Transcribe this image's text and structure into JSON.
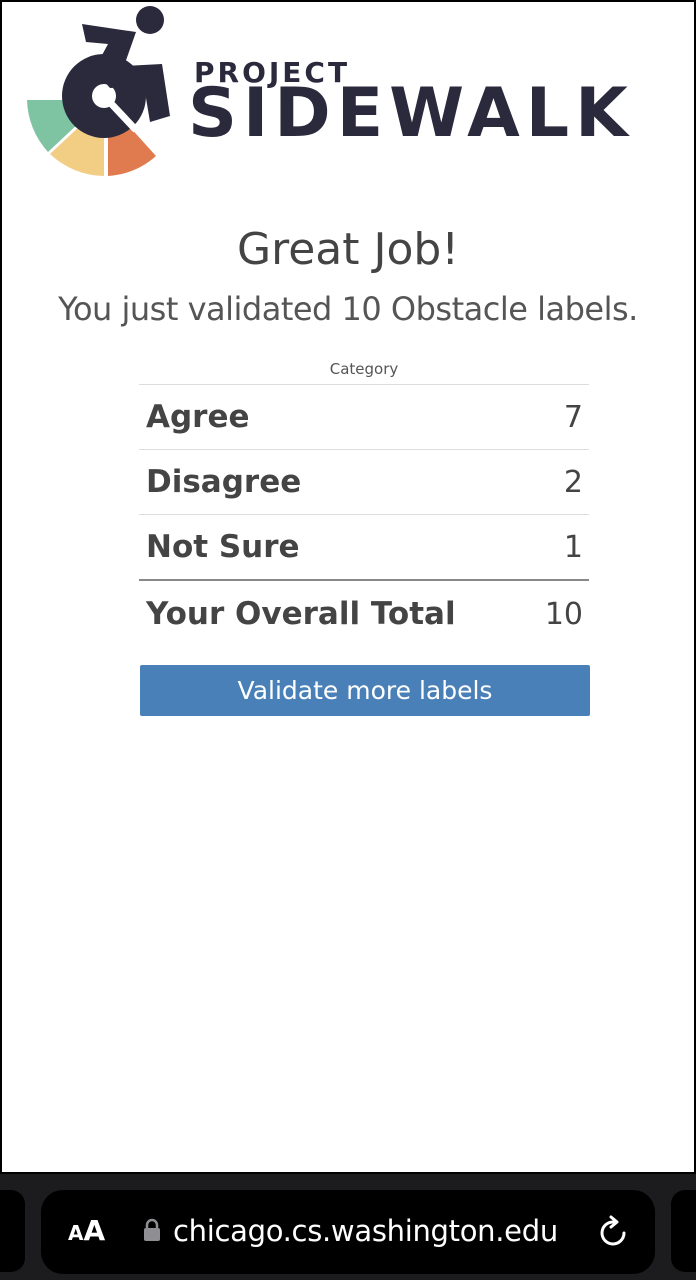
{
  "logo": {
    "line1": "PROJECT",
    "line2": "SIDEWALK",
    "colors": {
      "dark": "#2b2a3d",
      "green": "#7fc4a2",
      "yellow": "#f2cd84",
      "orange": "#e07b4f"
    }
  },
  "main": {
    "title": "Great Job!",
    "subtitle": "You just validated 10 Obstacle labels."
  },
  "stats": {
    "header": "Category",
    "rows": [
      {
        "label": "Agree",
        "value": "7"
      },
      {
        "label": "Disagree",
        "value": "2"
      },
      {
        "label": "Not Sure",
        "value": "1"
      }
    ],
    "total": {
      "label": "Your Overall Total",
      "value": "10"
    }
  },
  "actions": {
    "validate_more": "Validate more labels",
    "button_color": "#4a80b8"
  },
  "browser": {
    "aa_small": "A",
    "aa_large": "A",
    "url": "chicago.cs.washington.edu",
    "icons": [
      "text-size-icon",
      "lock-icon",
      "reload-icon"
    ]
  }
}
